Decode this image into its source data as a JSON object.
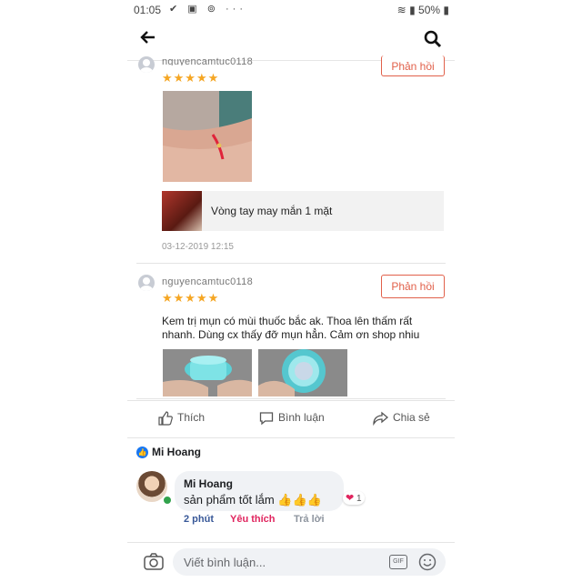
{
  "status_bar": {
    "time": "01:05",
    "icons": "✔ ▣ ⊚ ···",
    "battery": "50%"
  },
  "reviews": [
    {
      "username": "nguyencamtuc0118",
      "stars": "★★★★★",
      "reply_label": "Phản hồi",
      "product_name": "Vòng tay may mắn 1 mặt",
      "timestamp": "03-12-2019 12:15"
    },
    {
      "username": "nguyencamtuc0118",
      "stars": "★★★★★",
      "reply_label": "Phản hồi",
      "text_line1": "Kem trị mụn có mùi thuốc bắc ak. Thoa lên thấm rất",
      "text_line2": "nhanh. Dùng cx thấy đỡ mụn hẳn. Cảm ơn shop nhiu"
    }
  ],
  "actions": {
    "like": "Thích",
    "comment": "Bình luận",
    "share": "Chia sẻ"
  },
  "sharer_name": "Mi Hoang",
  "comment": {
    "author": "Mi Hoang",
    "text": "sản phẩm tốt lắm 👍👍👍",
    "reaction_count": "1",
    "time": "2 phút",
    "liked_label": "Yêu thích",
    "reply_label": "Trả lời"
  },
  "composer": {
    "placeholder": "Viết bình luận...",
    "gif": "GIF"
  },
  "colors": {
    "accent_orange": "#e1604a",
    "star": "#f5a623",
    "fb_blue": "#1877f2",
    "like_red": "#e0245e"
  }
}
